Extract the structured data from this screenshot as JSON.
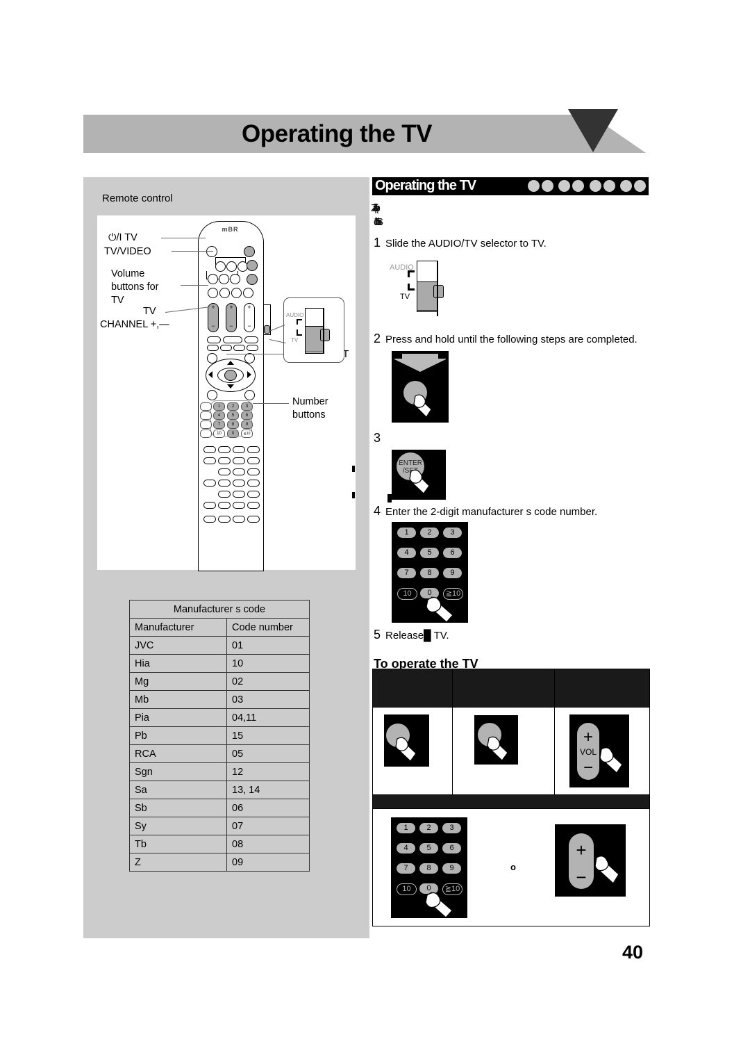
{
  "document": {
    "title": "Operating the TV",
    "page_number": "40"
  },
  "left_panel": {
    "caption": "Remote control",
    "remote_brand": "mBR",
    "callouts": [
      {
        "label": "⏻/I TV"
      },
      {
        "label": "TV/VIDEO"
      },
      {
        "label": "Volume"
      },
      {
        "label": "buttons for"
      },
      {
        "label": "TV"
      },
      {
        "label": "TV"
      },
      {
        "label": "CHANNEL +,—"
      },
      {
        "label": "ENTER/SET"
      },
      {
        "label": "Number"
      },
      {
        "label": "buttons"
      }
    ],
    "selector_callout": {
      "audio_label": "AUDIO",
      "tv_label": "TV"
    },
    "remote_keypad_digits": [
      "1",
      "2",
      "3",
      "4",
      "5",
      "6",
      "7",
      "8",
      "9",
      "10",
      "0",
      "≧10"
    ]
  },
  "code_table": {
    "title": "Manufacturer s code",
    "headers": [
      "Manufacturer",
      "Code number"
    ],
    "rows": [
      {
        "manufacturer": "JVC",
        "code": "01"
      },
      {
        "manufacturer": "Hia",
        "code": "10"
      },
      {
        "manufacturer": "Mg",
        "code": "02"
      },
      {
        "manufacturer": "Mb",
        "code": "03"
      },
      {
        "manufacturer": "Pia",
        "code": "04,11"
      },
      {
        "manufacturer": "Pb",
        "code": "15"
      },
      {
        "manufacturer": "RCA",
        "code": "05"
      },
      {
        "manufacturer": "Sgn",
        "code": "12"
      },
      {
        "manufacturer": "Sa",
        "code": "13, 14"
      },
      {
        "manufacturer": "Sb",
        "code": "06"
      },
      {
        "manufacturer": "Sy",
        "code": "07"
      },
      {
        "manufacturer": "Tb",
        "code": "08"
      },
      {
        "manufacturer": "Z",
        "code": "09"
      }
    ]
  },
  "right_column": {
    "section_title": "Operating the TV",
    "section_dots_count": 8,
    "intro_line1": "upl/Zãõvę",
    "intro_line2": "đħħSın",
    "steps": [
      {
        "number": "1",
        "text": "Slide the AUDIO/TV selector to  TV."
      },
      {
        "number": "2",
        "text": "Press and hold until the following steps are completed."
      },
      {
        "number": "3",
        "text": ""
      },
      {
        "number": "4",
        "text": "Enter the 2-digit manufacturer s code number."
      },
      {
        "number": "5",
        "text": "Release█   TV."
      }
    ],
    "selector_diagram": {
      "audio_label": "AUDIO",
      "tv_label": "TV"
    },
    "enter_set_label": "ENTER\n/SET",
    "enter_set_line1": "ENTER",
    "enter_set_line2": "/SET",
    "keypad_digits": [
      "1",
      "2",
      "3",
      "4",
      "5",
      "6",
      "7",
      "8",
      "9",
      "10",
      "0",
      "≧10"
    ],
    "subhead": "To operate the TV",
    "operate_table": {
      "header_cells": [
        "",
        "",
        ""
      ],
      "header_row2": "",
      "cell_note": "o",
      "vol_label": "VOL"
    }
  }
}
